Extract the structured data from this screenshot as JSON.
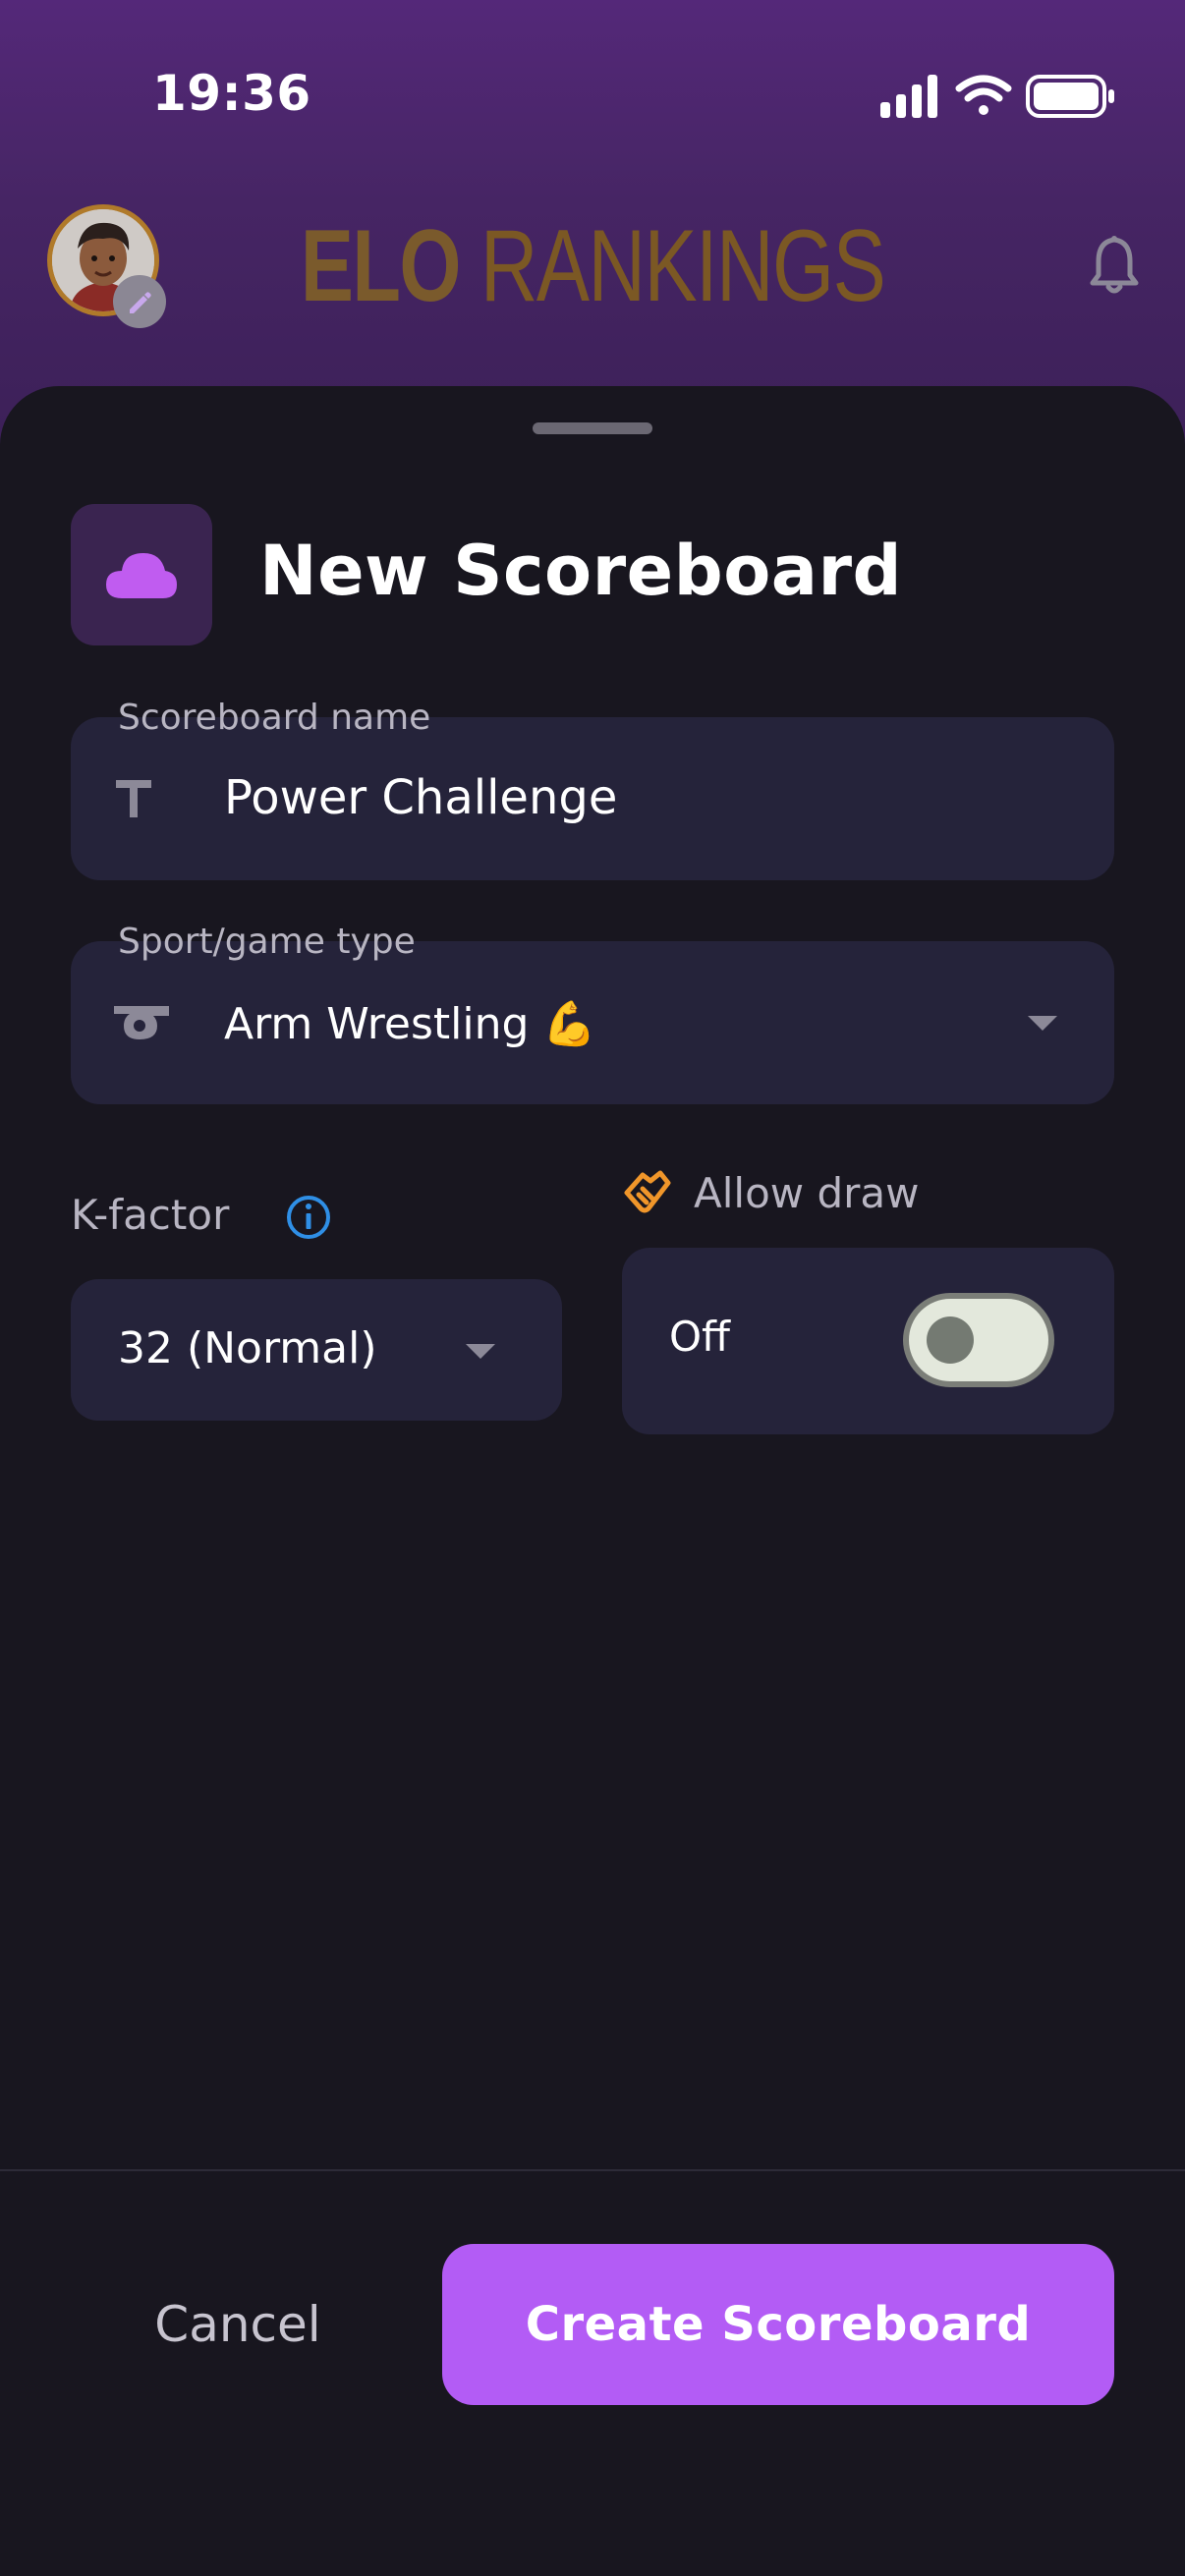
{
  "status_bar": {
    "time": "19:36"
  },
  "header": {
    "title_part1": "ELO",
    "title_part2": "RANKINGS"
  },
  "sheet": {
    "title": "New Scoreboard"
  },
  "form": {
    "name_field": {
      "label": "Scoreboard name",
      "value": "Power Challenge"
    },
    "sport_field": {
      "label": "Sport/game type",
      "value": "Arm Wrestling 💪"
    },
    "kfactor": {
      "label": "K-factor",
      "value": "32 (Normal)"
    },
    "allow_draw": {
      "label": "Allow draw",
      "state": "Off",
      "enabled": false
    }
  },
  "actions": {
    "cancel": "Cancel",
    "create": "Create Scoreboard"
  },
  "colors": {
    "header_gradient_top": "#542879",
    "background": "#18161f",
    "field_bg": "#25233a",
    "primary_button": "#b35cf5",
    "title_gold": "#7a5a2c",
    "info_blue": "#2f8fe6",
    "draw_icon_orange": "#f0962a"
  },
  "icons": {
    "avatar": "user-avatar",
    "avatar_edit": "pencil-icon",
    "notification": "bell-icon",
    "sheet_title": "cloud-icon",
    "name_field": "text-t-icon",
    "sport_field": "whistle-icon",
    "kfactor_info": "info-icon",
    "allow_draw": "handshake-icon",
    "dropdown": "caret-down-icon"
  }
}
